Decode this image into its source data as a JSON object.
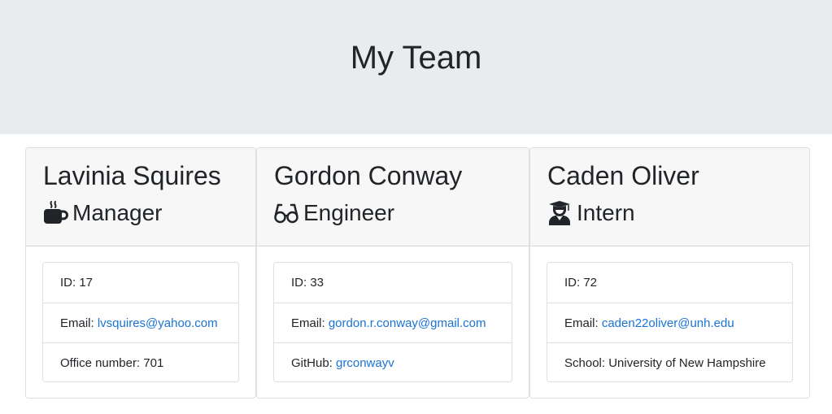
{
  "header": {
    "title": "My Team"
  },
  "colors": {
    "link": "#1a73d4",
    "jumbotron": "#e9ecef",
    "card_header": "#f7f7f7",
    "text": "#212529"
  },
  "cards": [
    {
      "name": "Lavinia Squires",
      "role": "Manager",
      "role_icon": "coffee-mug-icon",
      "id_label": "ID: 17",
      "email_prefix": "Email: ",
      "email": "lvsquires@yahoo.com",
      "extra_prefix": "Office number: 701",
      "extra_link": ""
    },
    {
      "name": "Gordon Conway",
      "role": "Engineer",
      "role_icon": "glasses-icon",
      "id_label": "ID: 33",
      "email_prefix": "Email: ",
      "email": "gordon.r.conway@gmail.com",
      "extra_prefix": "GitHub: ",
      "extra_link": "grconwayv"
    },
    {
      "name": "Caden Oliver",
      "role": "Intern",
      "role_icon": "graduate-icon",
      "id_label": "ID: 72",
      "email_prefix": "Email: ",
      "email": "caden22oliver@unh.edu",
      "extra_prefix": "School: University of New Hampshire",
      "extra_link": ""
    }
  ]
}
